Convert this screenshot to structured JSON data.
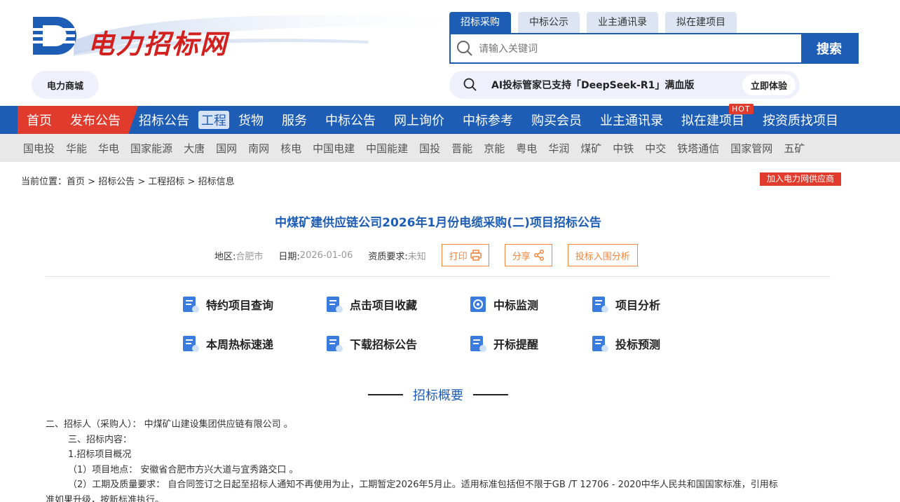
{
  "header": {
    "logo_text": "电力招标网",
    "tabs": [
      "招标采购",
      "中标公示",
      "业主通讯录",
      "拟在建项目"
    ],
    "search": {
      "placeholder": "请输入关键词",
      "button": "搜索"
    },
    "mall_button": "电力商城",
    "ai_bar": {
      "text": "AI投标管家已支持「DeepSeek-R1」满血版",
      "button": "立即体验"
    }
  },
  "mainnav": {
    "items": [
      "首页",
      "发布公告",
      "招标公告",
      "工程",
      "货物",
      "服务",
      "中标公告",
      "网上询价",
      "中标参考",
      "购买会员",
      "业主通讯录",
      "拟在建项目",
      "按资质找项目"
    ],
    "hot_badge": "HOT"
  },
  "subnav": [
    "国电投",
    "华能",
    "华电",
    "国家能源",
    "大唐",
    "国网",
    "南网",
    "核电",
    "中国电建",
    "中国能建",
    "国投",
    "晋能",
    "京能",
    "粤电",
    "华润",
    "煤矿",
    "中铁",
    "中交",
    "铁塔通信",
    "国家管网",
    "五矿"
  ],
  "breadcrumb": {
    "prefix": "当前位置：",
    "items": [
      "首页",
      "招标公告",
      "工程招标",
      "招标信息"
    ],
    "separator": " > "
  },
  "join_button": "加入电力网供应商",
  "article": {
    "title": "中煤矿建供应链公司2026年1月份电缆采购(二)项目招标公告",
    "region_label": "地区:",
    "region": "合肥市",
    "date_label": "日期:",
    "date": "2026-01-06",
    "qual_label": "资质要求:",
    "qual": "未知",
    "print": "打印",
    "share": "分享",
    "bid_analysis": "投标入围分析"
  },
  "features": [
    "特约项目查询",
    "点击项目收藏",
    "中标监测",
    "项目分析",
    "本周热标速递",
    "下载招标公告",
    "开标提醒",
    "投标预测"
  ],
  "section_title": "招标概要",
  "content": {
    "line1": "二、招标人（采购人）：  中煤矿山建设集团供应链有限公司 。",
    "line2": "三、招标内容：",
    "line3": "1.招标项目概况",
    "line4": "（1）项目地点：  安徽省合肥市方兴大道与宜秀路交口 。",
    "line5": "（2）工期及质量要求：  自合同签订之日起至招标人通知不再使用为止，工期暂定2026年5月止。适用标准包括但不限于GB /T 12706 - 2020中华人民共和国国家标准，引用标",
    "line6": "准如果升级，按新标准执行。"
  },
  "colors": {
    "brand_blue": "#1d5db5",
    "accent_red": "#e13b2d",
    "orange": "#f0863f"
  }
}
